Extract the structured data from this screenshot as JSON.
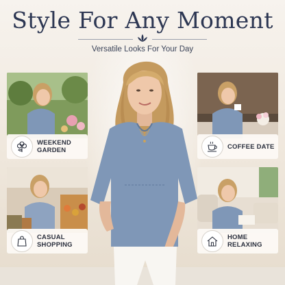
{
  "header": {
    "title": "Style For Any Moment",
    "subtitle": "Versatile Looks For Your Day"
  },
  "cards": [
    {
      "line1": "WEEKEND",
      "line2": "GARDEN",
      "icon": "flower-icon"
    },
    {
      "line1": "COFFEE DATE",
      "line2": "",
      "icon": "coffee-cup-icon"
    },
    {
      "line1": "CASUAL",
      "line2": "SHOPPING",
      "icon": "shopping-bag-icon"
    },
    {
      "line1": "HOME",
      "line2": "RELAXING",
      "icon": "house-icon"
    }
  ],
  "colors": {
    "background": "#f3ede6",
    "title": "#2c3652",
    "denim": "#7f97b7",
    "caption_bg": "#fcf9f5"
  }
}
